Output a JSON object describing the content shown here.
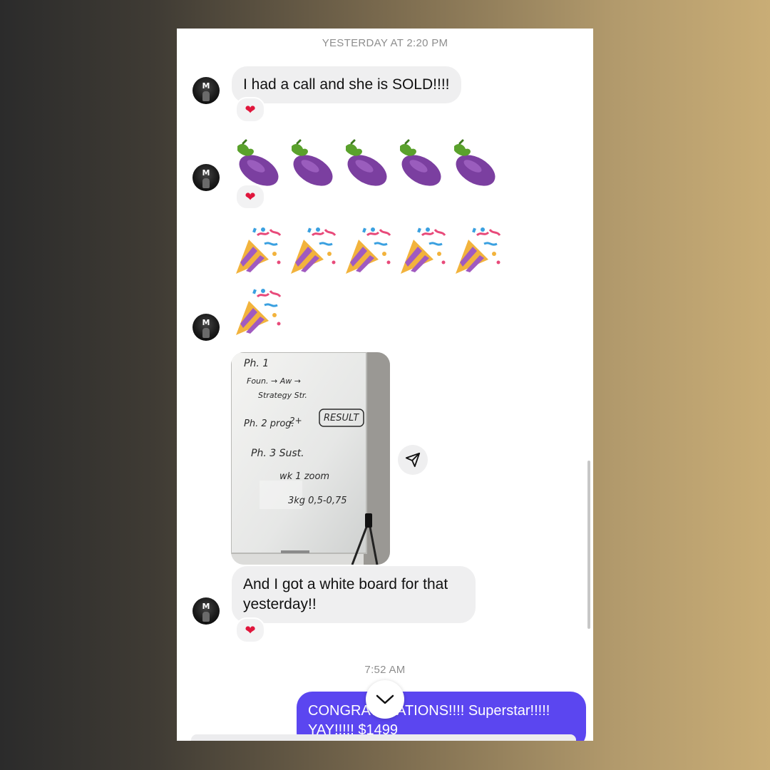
{
  "colors": {
    "outgoing_bubble": "#5b46f0",
    "incoming_bubble": "#efeff0",
    "reaction_heart": "#e0163c"
  },
  "timestamps": {
    "first": "YESTERDAY AT 2:20 PM",
    "second": "7:52 AM"
  },
  "messages": {
    "msg1": "I had a call and she is SOLD!!!!",
    "msg5": "And I got a white board for that yesterday!!",
    "outgoing": "CONGRATULATIONS!!!! Superstar!!!!! YAY!!!!! $1499"
  },
  "avatar": {
    "initial": "M"
  },
  "reactions": {
    "heart": "❤"
  },
  "emoji": {
    "eggplant_count": 5,
    "party_row1_count": 5,
    "party_row2_count": 1,
    "eggplant_icon": "eggplant-emoji",
    "party_icon": "party-popper-emoji"
  },
  "whiteboard": {
    "lines": [
      "Ph. 1",
      "Foun. → Aw →",
      "Strategy  Str.",
      "2+",
      "Ph. 2 prog.",
      "RESULT",
      "Ph. 3 Sust.",
      "wk 1  zoom",
      "3kg  0,5-0,75"
    ]
  },
  "icons": {
    "share": "share-icon",
    "scroll_down": "chevron-down-icon"
  }
}
